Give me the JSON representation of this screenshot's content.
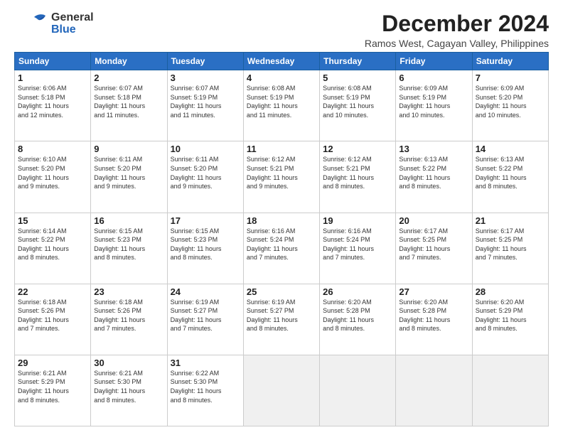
{
  "header": {
    "logo_general": "General",
    "logo_blue": "Blue",
    "title": "December 2024",
    "location": "Ramos West, Cagayan Valley, Philippines"
  },
  "columns": [
    "Sunday",
    "Monday",
    "Tuesday",
    "Wednesday",
    "Thursday",
    "Friday",
    "Saturday"
  ],
  "weeks": [
    [
      {
        "day": "1",
        "lines": [
          "Sunrise: 6:06 AM",
          "Sunset: 5:18 PM",
          "Daylight: 11 hours",
          "and 12 minutes."
        ]
      },
      {
        "day": "2",
        "lines": [
          "Sunrise: 6:07 AM",
          "Sunset: 5:18 PM",
          "Daylight: 11 hours",
          "and 11 minutes."
        ]
      },
      {
        "day": "3",
        "lines": [
          "Sunrise: 6:07 AM",
          "Sunset: 5:19 PM",
          "Daylight: 11 hours",
          "and 11 minutes."
        ]
      },
      {
        "day": "4",
        "lines": [
          "Sunrise: 6:08 AM",
          "Sunset: 5:19 PM",
          "Daylight: 11 hours",
          "and 11 minutes."
        ]
      },
      {
        "day": "5",
        "lines": [
          "Sunrise: 6:08 AM",
          "Sunset: 5:19 PM",
          "Daylight: 11 hours",
          "and 10 minutes."
        ]
      },
      {
        "day": "6",
        "lines": [
          "Sunrise: 6:09 AM",
          "Sunset: 5:19 PM",
          "Daylight: 11 hours",
          "and 10 minutes."
        ]
      },
      {
        "day": "7",
        "lines": [
          "Sunrise: 6:09 AM",
          "Sunset: 5:20 PM",
          "Daylight: 11 hours",
          "and 10 minutes."
        ]
      }
    ],
    [
      {
        "day": "8",
        "lines": [
          "Sunrise: 6:10 AM",
          "Sunset: 5:20 PM",
          "Daylight: 11 hours",
          "and 9 minutes."
        ]
      },
      {
        "day": "9",
        "lines": [
          "Sunrise: 6:11 AM",
          "Sunset: 5:20 PM",
          "Daylight: 11 hours",
          "and 9 minutes."
        ]
      },
      {
        "day": "10",
        "lines": [
          "Sunrise: 6:11 AM",
          "Sunset: 5:20 PM",
          "Daylight: 11 hours",
          "and 9 minutes."
        ]
      },
      {
        "day": "11",
        "lines": [
          "Sunrise: 6:12 AM",
          "Sunset: 5:21 PM",
          "Daylight: 11 hours",
          "and 9 minutes."
        ]
      },
      {
        "day": "12",
        "lines": [
          "Sunrise: 6:12 AM",
          "Sunset: 5:21 PM",
          "Daylight: 11 hours",
          "and 8 minutes."
        ]
      },
      {
        "day": "13",
        "lines": [
          "Sunrise: 6:13 AM",
          "Sunset: 5:22 PM",
          "Daylight: 11 hours",
          "and 8 minutes."
        ]
      },
      {
        "day": "14",
        "lines": [
          "Sunrise: 6:13 AM",
          "Sunset: 5:22 PM",
          "Daylight: 11 hours",
          "and 8 minutes."
        ]
      }
    ],
    [
      {
        "day": "15",
        "lines": [
          "Sunrise: 6:14 AM",
          "Sunset: 5:22 PM",
          "Daylight: 11 hours",
          "and 8 minutes."
        ]
      },
      {
        "day": "16",
        "lines": [
          "Sunrise: 6:15 AM",
          "Sunset: 5:23 PM",
          "Daylight: 11 hours",
          "and 8 minutes."
        ]
      },
      {
        "day": "17",
        "lines": [
          "Sunrise: 6:15 AM",
          "Sunset: 5:23 PM",
          "Daylight: 11 hours",
          "and 8 minutes."
        ]
      },
      {
        "day": "18",
        "lines": [
          "Sunrise: 6:16 AM",
          "Sunset: 5:24 PM",
          "Daylight: 11 hours",
          "and 7 minutes."
        ]
      },
      {
        "day": "19",
        "lines": [
          "Sunrise: 6:16 AM",
          "Sunset: 5:24 PM",
          "Daylight: 11 hours",
          "and 7 minutes."
        ]
      },
      {
        "day": "20",
        "lines": [
          "Sunrise: 6:17 AM",
          "Sunset: 5:25 PM",
          "Daylight: 11 hours",
          "and 7 minutes."
        ]
      },
      {
        "day": "21",
        "lines": [
          "Sunrise: 6:17 AM",
          "Sunset: 5:25 PM",
          "Daylight: 11 hours",
          "and 7 minutes."
        ]
      }
    ],
    [
      {
        "day": "22",
        "lines": [
          "Sunrise: 6:18 AM",
          "Sunset: 5:26 PM",
          "Daylight: 11 hours",
          "and 7 minutes."
        ]
      },
      {
        "day": "23",
        "lines": [
          "Sunrise: 6:18 AM",
          "Sunset: 5:26 PM",
          "Daylight: 11 hours",
          "and 7 minutes."
        ]
      },
      {
        "day": "24",
        "lines": [
          "Sunrise: 6:19 AM",
          "Sunset: 5:27 PM",
          "Daylight: 11 hours",
          "and 7 minutes."
        ]
      },
      {
        "day": "25",
        "lines": [
          "Sunrise: 6:19 AM",
          "Sunset: 5:27 PM",
          "Daylight: 11 hours",
          "and 8 minutes."
        ]
      },
      {
        "day": "26",
        "lines": [
          "Sunrise: 6:20 AM",
          "Sunset: 5:28 PM",
          "Daylight: 11 hours",
          "and 8 minutes."
        ]
      },
      {
        "day": "27",
        "lines": [
          "Sunrise: 6:20 AM",
          "Sunset: 5:28 PM",
          "Daylight: 11 hours",
          "and 8 minutes."
        ]
      },
      {
        "day": "28",
        "lines": [
          "Sunrise: 6:20 AM",
          "Sunset: 5:29 PM",
          "Daylight: 11 hours",
          "and 8 minutes."
        ]
      }
    ],
    [
      {
        "day": "29",
        "lines": [
          "Sunrise: 6:21 AM",
          "Sunset: 5:29 PM",
          "Daylight: 11 hours",
          "and 8 minutes."
        ]
      },
      {
        "day": "30",
        "lines": [
          "Sunrise: 6:21 AM",
          "Sunset: 5:30 PM",
          "Daylight: 11 hours",
          "and 8 minutes."
        ]
      },
      {
        "day": "31",
        "lines": [
          "Sunrise: 6:22 AM",
          "Sunset: 5:30 PM",
          "Daylight: 11 hours",
          "and 8 minutes."
        ]
      },
      null,
      null,
      null,
      null
    ]
  ]
}
